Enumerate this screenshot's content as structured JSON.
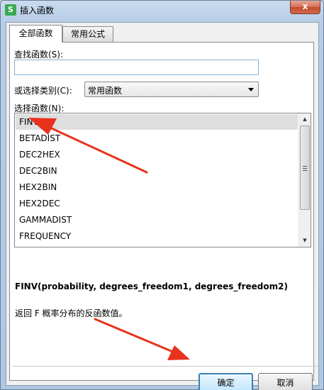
{
  "window": {
    "app_icon": "S",
    "title": "插入函数",
    "close": "x"
  },
  "tabs": [
    {
      "label": "全部函数",
      "active": true
    },
    {
      "label": "常用公式",
      "active": false
    }
  ],
  "search": {
    "label": "查找函数(S):",
    "value": "",
    "placeholder": ""
  },
  "category": {
    "label": "或选择类别(C):",
    "selected": "常用函数"
  },
  "function_list": {
    "label": "选择函数(N):",
    "items": [
      "FINV",
      "BETADIST",
      "DEC2HEX",
      "DEC2BIN",
      "HEX2BIN",
      "HEX2DEC",
      "GAMMADIST",
      "FREQUENCY"
    ],
    "selected_index": 0
  },
  "signature": "FINV(probability, degrees_freedom1, degrees_freedom2)",
  "description": "返回 F 概率分布的反函数值。",
  "buttons": {
    "ok": "确定",
    "cancel": "取消"
  },
  "colors": {
    "annotation_arrow": "#e8321c",
    "selected_row": "#dedede",
    "ok_border": "#3c7fb1"
  }
}
